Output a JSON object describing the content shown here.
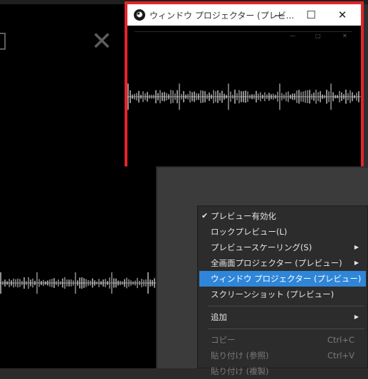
{
  "projector": {
    "title": "ウィンドウ プロジェクター (プレビ...",
    "minimize_glyph": "—",
    "maximize_glyph": "☐",
    "close_glyph": "✕"
  },
  "background": {
    "close_glyph": "✕"
  },
  "menu": {
    "items": [
      {
        "label": "プレビュー有効化",
        "checked": true
      },
      {
        "label": "ロックプレビュー(L)"
      },
      {
        "label": "プレビュースケーリング(S)",
        "submenu": true
      },
      {
        "label": "全画面プロジェクター (プレビュー)",
        "submenu": true
      },
      {
        "label": "ウィンドウ プロジェクター (プレビュー)",
        "highlighted": true
      },
      {
        "label": "スクリーンショット (プレビュー)"
      },
      {
        "label": "追加",
        "submenu": true
      },
      {
        "label": "コピー",
        "shortcut": "Ctrl+C",
        "disabled": true
      },
      {
        "label": "貼り付け (参照)",
        "shortcut": "Ctrl+V",
        "disabled": true
      },
      {
        "label": "貼り付け (複製)",
        "disabled": true
      }
    ],
    "check_glyph": "✔",
    "arrow_glyph": "▶"
  },
  "colors": {
    "highlight": "#2f86d9",
    "projector_border": "#e0262a"
  }
}
